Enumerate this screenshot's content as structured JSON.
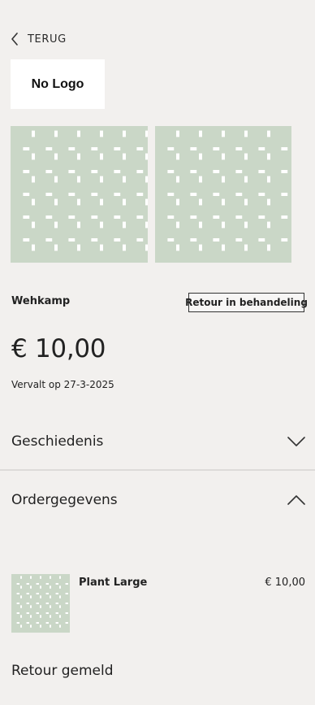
{
  "nav": {
    "back_label": "TERUG",
    "back_icon": "chevron-left-icon"
  },
  "merchant": {
    "logo_text": "No Logo",
    "name": "Wehkamp"
  },
  "images": {
    "placeholder_color": "#cad7c7",
    "count": 2
  },
  "order": {
    "status_badge": "Retour in behandeling",
    "amount": "€ 10,00",
    "due_text": "Vervalt op 27-3-2025"
  },
  "sections": {
    "history": {
      "title": "Geschiedenis",
      "icon": "chevron-down-icon",
      "expanded": false
    },
    "order_details": {
      "title": "Ordergegevens",
      "icon": "chevron-up-icon",
      "expanded": true
    }
  },
  "product": {
    "name": "Plant Large",
    "price": "€ 10,00"
  },
  "return_status": "Retour gemeld"
}
